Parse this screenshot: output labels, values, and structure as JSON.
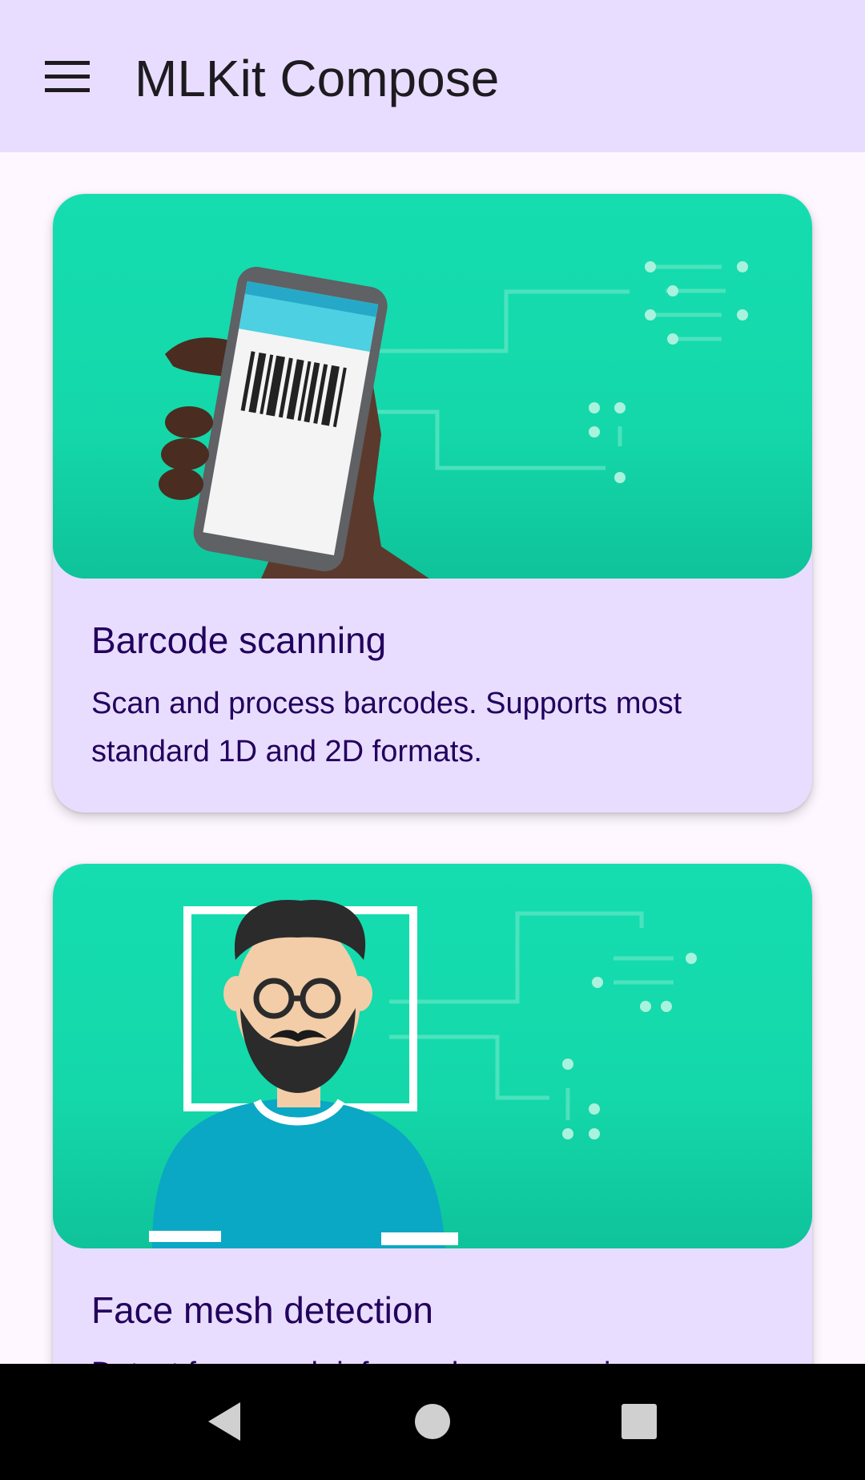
{
  "app_bar": {
    "title": "MLKit Compose",
    "menu_icon": "hamburger-menu-icon"
  },
  "cards": [
    {
      "title": "Barcode scanning",
      "description": "Scan and process barcodes. Supports most standard 1D and 2D formats.",
      "illustration": "phone-scanning-barcode-illustration"
    },
    {
      "title": "Face mesh detection",
      "description": "Detect face mesh info on close-range images.",
      "illustration": "face-in-frame-illustration"
    }
  ],
  "system_nav": {
    "back_icon": "back-triangle-icon",
    "home_icon": "home-circle-icon",
    "recents_icon": "recents-square-icon"
  },
  "colors": {
    "app_bar_bg": "#e9ddff",
    "card_bg": "#e9ddff",
    "card_text": "#22005d",
    "illustration_bg": "#12d8a8",
    "page_bg": "#fef7ff"
  }
}
